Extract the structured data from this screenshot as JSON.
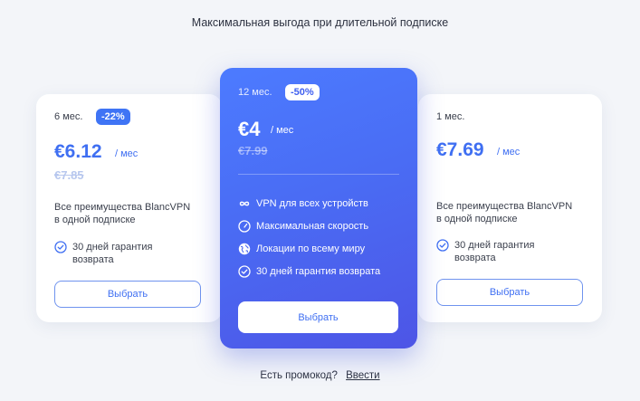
{
  "headline": "Максимальная выгода при длительной подписке",
  "plans": {
    "six": {
      "period": "6 мес.",
      "badge": "-22%",
      "price": "€6.12",
      "per": "/ мес",
      "old_price": "€7.85",
      "description": [
        "Все преимущества BlancVPN",
        "в одной подписке"
      ],
      "guarantee": [
        "30 дней гарантия",
        "возврата"
      ],
      "button": "Выбрать"
    },
    "twelve": {
      "period": "12 мес.",
      "badge": "-50%",
      "price": "€4",
      "per": "/ мес",
      "old_price": "€7.99",
      "features": [
        "VPN для всех устройств",
        "Максимальная скорость",
        "Локации по всему миру",
        "30 дней гарантия возврата"
      ],
      "button": "Выбрать"
    },
    "one": {
      "period": "1 мес.",
      "price": "€7.69",
      "per": "/ мес",
      "description": [
        "Все преимущества BlancVPN",
        "в одной подписке"
      ],
      "guarantee": [
        "30 дней гарантия",
        "возврата"
      ],
      "button": "Выбрать"
    }
  },
  "promo": {
    "question": "Есть промокод?",
    "link": "Ввести"
  },
  "colors": {
    "accent": "#3f6ff2",
    "card_gradient_start": "#4c7bff",
    "card_gradient_end": "#4d55e6"
  }
}
